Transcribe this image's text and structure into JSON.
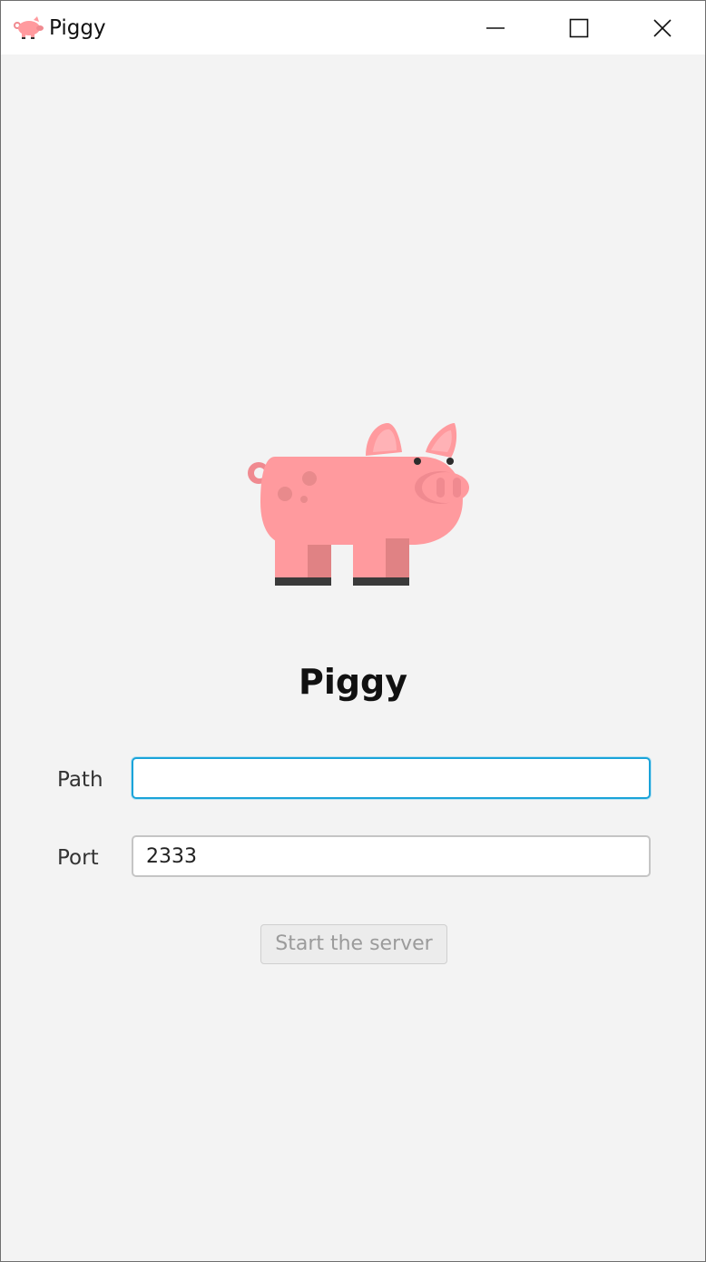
{
  "window": {
    "title": "Piggy",
    "app_icon": "pig-icon",
    "controls": {
      "minimize_icon": "minimize-icon",
      "maximize_icon": "maximize-icon",
      "close_icon": "close-icon"
    }
  },
  "main": {
    "logo": "pig-illustration",
    "heading": "Piggy",
    "path": {
      "label": "Path",
      "value": "",
      "placeholder": ""
    },
    "port": {
      "label": "Port",
      "value": "2333"
    },
    "start_button": {
      "label": "Start the server",
      "enabled": false
    }
  },
  "colors": {
    "pig_pink": "#FF9A9E",
    "focus_border": "#1AA3D9",
    "background": "#F3F3F3"
  }
}
